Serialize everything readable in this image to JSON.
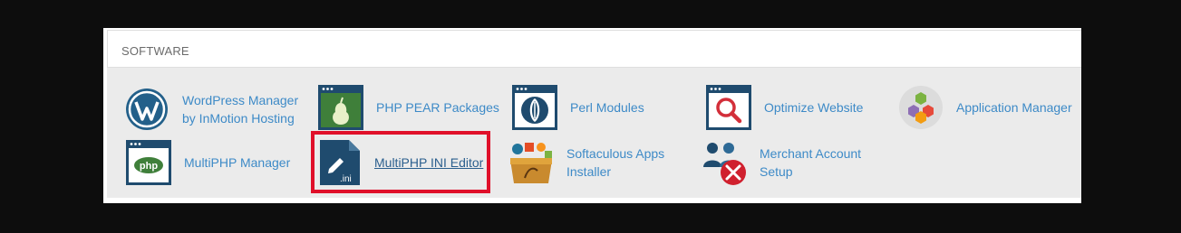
{
  "section": {
    "title": "SOFTWARE"
  },
  "items": [
    {
      "label": "WordPress Manager\nby InMotion Hosting",
      "icon": "wordpress-icon"
    },
    {
      "label": "PHP PEAR Packages",
      "icon": "pear-icon"
    },
    {
      "label": "Perl Modules",
      "icon": "perl-onion-icon"
    },
    {
      "label": "Optimize Website",
      "icon": "magnifier-icon"
    },
    {
      "label": "Application Manager",
      "icon": "cubes-icon"
    },
    {
      "label": "MultiPHP Manager",
      "icon": "php-icon"
    },
    {
      "label": "MultiPHP INI Editor",
      "icon": "ini-file-edit-icon"
    },
    {
      "label": "Softaculous Apps\nInstaller",
      "icon": "softaculous-box-icon"
    },
    {
      "label": "Merchant Account\nSetup",
      "icon": "merchant-users-tools-icon"
    }
  ],
  "colors": {
    "link": "#3d8ac7",
    "highlight": "#e0102a",
    "icon_dark": "#1f4b6e",
    "panel_bg": "#ebebeb"
  }
}
